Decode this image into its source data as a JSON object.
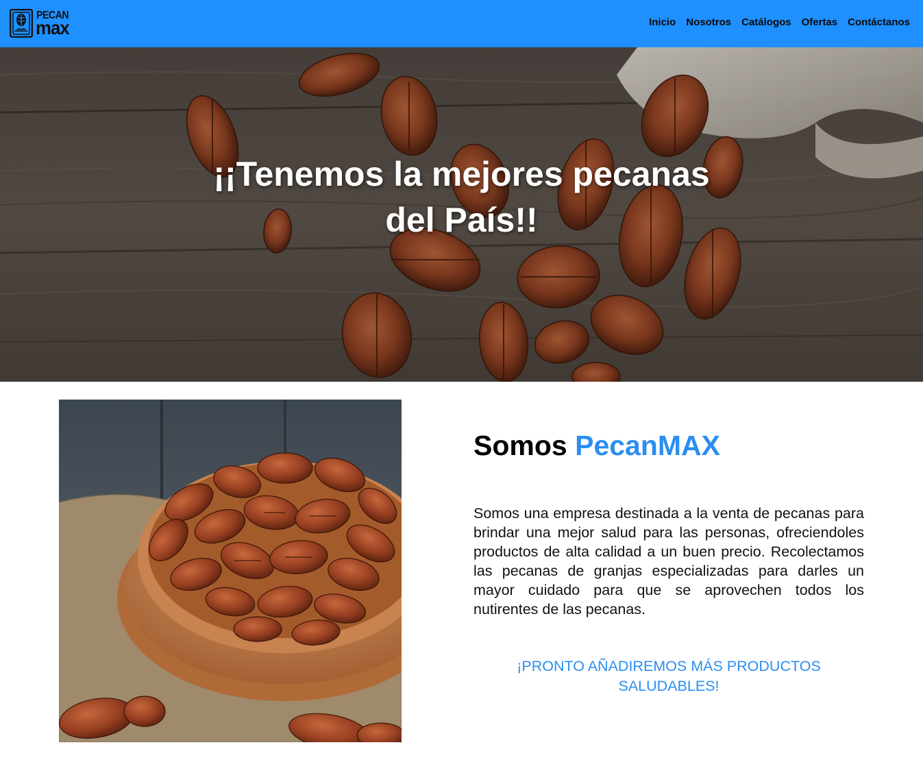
{
  "brand": {
    "logo_line1": "PECAN",
    "logo_line2": "max"
  },
  "nav": {
    "items": [
      {
        "label": "Inicio"
      },
      {
        "label": "Nosotros"
      },
      {
        "label": "Catálogos"
      },
      {
        "label": "Ofertas"
      },
      {
        "label": "Contáctanos"
      }
    ]
  },
  "hero": {
    "title_line1": "¡¡Tenemos la mejores pecanas",
    "title_line2": "del País!!"
  },
  "about": {
    "heading_prefix": "Somos",
    "heading_brand": "PecanMAX",
    "description": "Somos una empresa destinada a la venta de pecanas para brindar una mejor salud para las personas, ofreciendoles productos de alta calidad a un buen precio. Recolectamos las pecanas de granjas especializadas para darles un mayor cuidado para que se aprovechen todos los nutirentes de las pecanas.",
    "announcement_line1": "¡PRONTO AÑADIREMOS MÁS PRODUCTOS",
    "announcement_line2": "SALUDABLES!"
  },
  "colors": {
    "navbar": "#1e90ff",
    "accent": "#2b8ef0",
    "text": "#111111"
  },
  "icons": {
    "logo": "pecan-emblem-icon"
  }
}
